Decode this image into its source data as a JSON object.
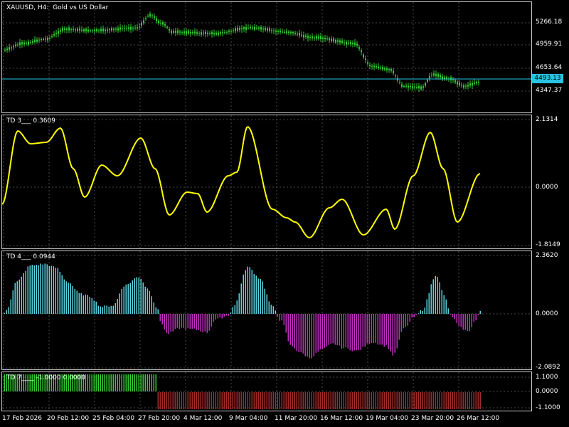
{
  "colors": {
    "background": "#000000",
    "grid": "#4a4a4a",
    "candle": "#32cd32",
    "price_line": "#29c3e3",
    "td3_line": "#ffff00",
    "td4_positive": "#5ad5e0",
    "td4_negative": "#c030c0",
    "td7_positive": "#32cd32",
    "td7_negative": "#a52a2a"
  },
  "main": {
    "title": "XAUUSD, H4:  Gold vs US Dollar",
    "current_price": "4493.13",
    "y_ticks": [
      "5266.18",
      "4959.91",
      "4653.64",
      "4347.37"
    ]
  },
  "td3": {
    "label": "TD 3___ 0.3609",
    "y_ticks": [
      "2.1314",
      "0.0000",
      "-1.8149"
    ]
  },
  "td4": {
    "label": "TD 4___ 0.0944",
    "y_ticks": [
      "2.3620",
      "0.0000",
      "-2.0892"
    ]
  },
  "td7": {
    "label": "TD 7____ -1.0000 0.0000",
    "y_ticks": [
      "1.1000",
      "0.0000",
      "-1.1000"
    ]
  },
  "x_axis": {
    "labels": [
      "17 Feb 2026",
      "20 Feb 12:00",
      "25 Feb 04:00",
      "27 Feb 20:00",
      "4 Mar 12:00",
      "9 Mar 04:00",
      "11 Mar 20:00",
      "16 Mar 12:00",
      "19 Mar 04:00",
      "23 Mar 20:00",
      "26 Mar 12:00"
    ]
  }
}
